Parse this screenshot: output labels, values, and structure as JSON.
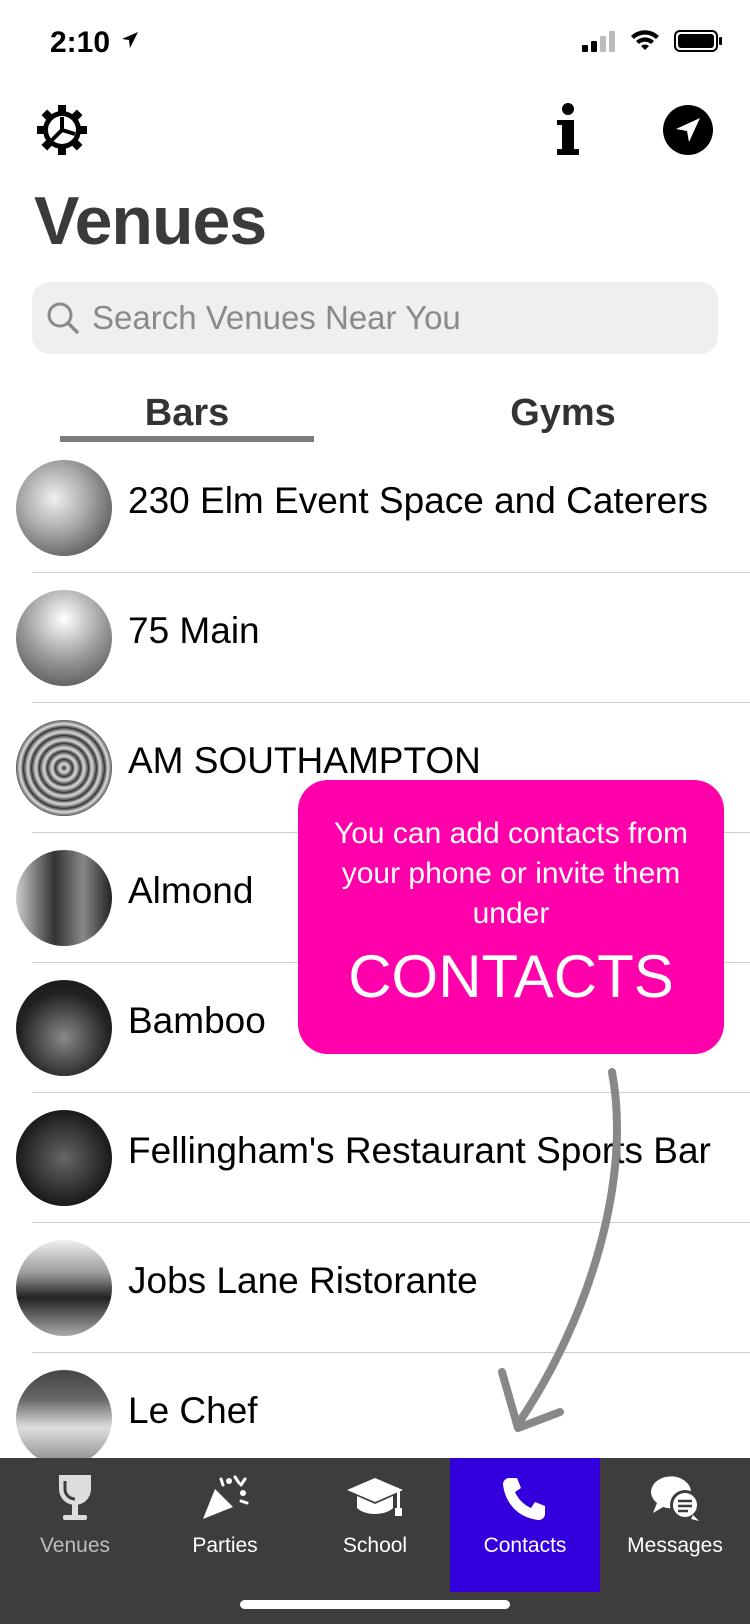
{
  "status": {
    "time": "2:10"
  },
  "header": {
    "title": "Venues"
  },
  "search": {
    "placeholder": "Search Venues Near You"
  },
  "tabs": {
    "bars": "Bars",
    "gyms": "Gyms"
  },
  "venues": [
    {
      "name": "230 Elm Event Space and Caterers"
    },
    {
      "name": "75 Main"
    },
    {
      "name": "AM SOUTHAMPTON"
    },
    {
      "name": "Almond"
    },
    {
      "name": "Bamboo"
    },
    {
      "name": "Fellingham's Restaurant Sports Bar"
    },
    {
      "name": "Jobs Lane Ristorante"
    },
    {
      "name": "Le Chef"
    }
  ],
  "tooltip": {
    "message": "You can add contacts from your phone or invite them under",
    "highlight": "CONTACTS",
    "color": "#ff00aa"
  },
  "tabbar": {
    "items": [
      {
        "label": "Venues",
        "icon": "wine-glass-icon"
      },
      {
        "label": "Parties",
        "icon": "party-popper-icon"
      },
      {
        "label": "School",
        "icon": "graduation-cap-icon"
      },
      {
        "label": "Contacts",
        "icon": "phone-icon",
        "active": true
      },
      {
        "label": "Messages",
        "icon": "chat-bubbles-icon"
      }
    ],
    "active_color": "#3300dd"
  }
}
